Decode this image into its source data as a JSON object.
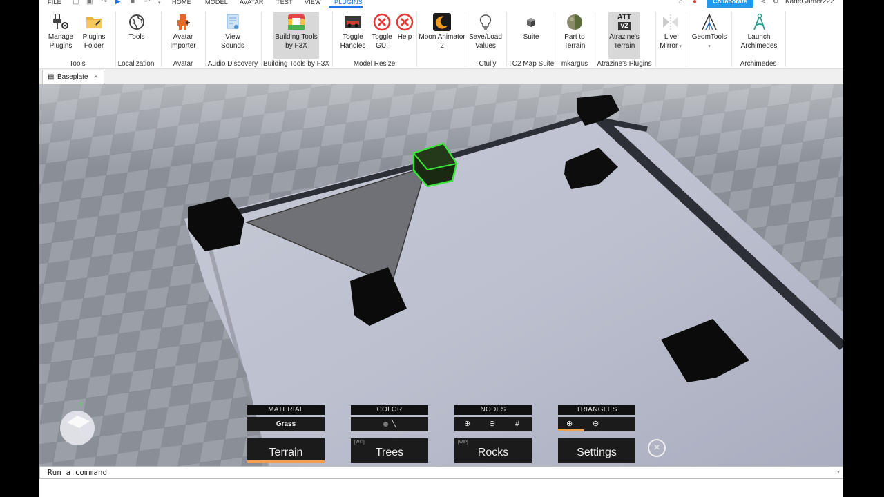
{
  "menu": {
    "file": "FILE",
    "tabs": [
      "HOME",
      "MODEL",
      "AVATAR",
      "TEST",
      "VIEW",
      "PLUGINS"
    ],
    "active_tab": "PLUGINS",
    "collaborate": "Collaborate",
    "username": "KadeGamer222"
  },
  "ribbon": {
    "buttons": [
      {
        "label1": "Manage",
        "label2": "Plugins",
        "icon": "plug-gear-icon"
      },
      {
        "label1": "Plugins",
        "label2": "Folder",
        "icon": "folder-icon"
      },
      {
        "label1": "Tools",
        "label2": "",
        "icon": "globe-icon"
      },
      {
        "label1": "Avatar",
        "label2": "Importer",
        "icon": "avatar-importer-icon"
      },
      {
        "label1": "View",
        "label2": "Sounds",
        "icon": "sound-document-icon"
      },
      {
        "label1": "Building Tools",
        "label2": "by F3X",
        "icon": "f3x-icon"
      },
      {
        "label1": "Toggle",
        "label2": "Handles",
        "icon": "car-icon"
      },
      {
        "label1": "Toggle",
        "label2": "GUI",
        "icon": "red-x-icon"
      },
      {
        "label1": "Help",
        "label2": "",
        "icon": "red-x-icon"
      },
      {
        "label1": "Moon Animator",
        "label2": "2",
        "icon": "moon-icon"
      },
      {
        "label1": "Save/Load",
        "label2": "Values",
        "icon": "lightbulb-icon"
      },
      {
        "label1": "Suite",
        "label2": "",
        "icon": "cube-icon"
      },
      {
        "label1": "Part to",
        "label2": "Terrain",
        "icon": "sphere-icon"
      },
      {
        "label1": "Atrazine's",
        "label2": "Terrain",
        "icon": "att-v2-icon",
        "badge1": "ATT",
        "badge2": "v2"
      },
      {
        "label1": "Live",
        "label2": "Mirror",
        "icon": "mirror-icon"
      },
      {
        "label1": "GeomTools",
        "label2": "",
        "icon": "geomtools-icon"
      },
      {
        "label1": "Launch",
        "label2": "Archimedes",
        "icon": "compass-icon"
      }
    ],
    "groups": [
      "Tools",
      "Localization",
      "Avatar",
      "Audio Discovery",
      "Building Tools by F3X",
      "Model Resize",
      "TCtully",
      "TC2 Map Suite",
      "mkargus",
      "Atrazine's Plugins",
      "Archimedes"
    ]
  },
  "document": {
    "tab_title": "Baseplate"
  },
  "hud": {
    "material": {
      "label": "MATERIAL",
      "value": "Grass"
    },
    "color": {
      "label": "COLOR"
    },
    "nodes": {
      "label": "NODES"
    },
    "triangles": {
      "label": "TRIANGLES"
    },
    "tabs": [
      {
        "label": "Terrain",
        "wip": "",
        "active": true
      },
      {
        "label": "Trees",
        "wip": "[WIP]",
        "active": false
      },
      {
        "label": "Rocks",
        "wip": "[WIP]",
        "active": false
      },
      {
        "label": "Settings",
        "wip": "",
        "active": false
      }
    ],
    "accent": "#f0a050"
  },
  "command_bar": {
    "placeholder": "Run a command"
  },
  "colors": {
    "accent": "#1e9bf0",
    "selection": "#39e639"
  }
}
